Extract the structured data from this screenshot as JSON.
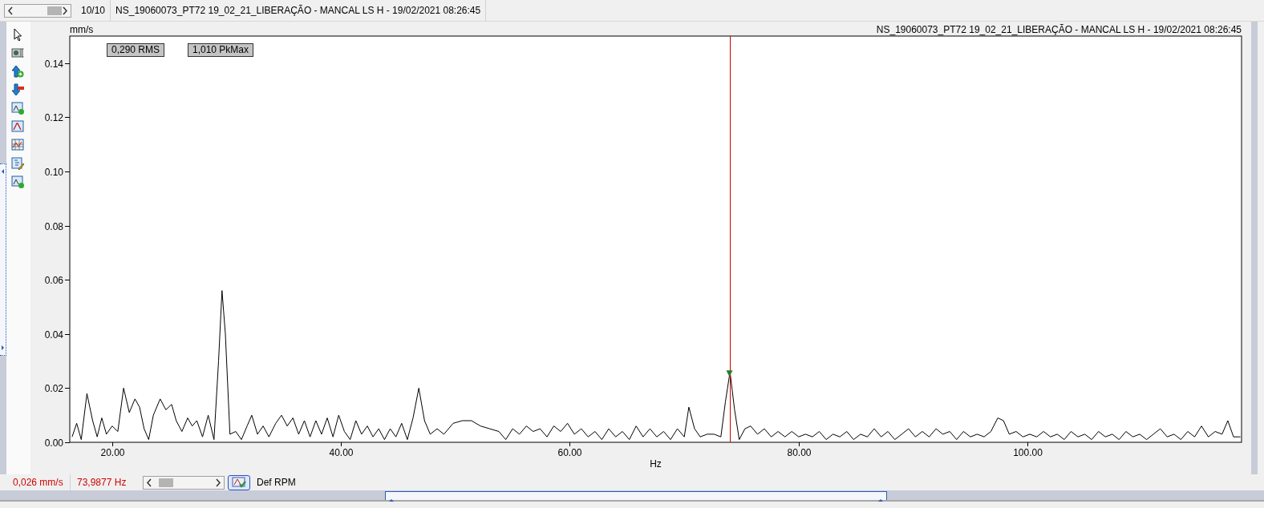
{
  "header": {
    "counter": "10/10",
    "title": "NS_19060073_PT72 19_02_21_LIBERAÇÃO - MANCAL LS H - 19/02/2021 08:26:45"
  },
  "chart": {
    "readouts": [
      "0,290 RMS",
      "1,010 PkMax"
    ],
    "chart_data": {
      "type": "line",
      "title": "NS_19060073_PT72 19_02_21_LIBERAÇÃO - MANCAL LS H - 19/02/2021 08:26:45",
      "xlabel": "Hz",
      "ylabel": "mm/s",
      "x": [
        16.5,
        16.9,
        17.3,
        17.8,
        18.3,
        18.7,
        19.1,
        19.5,
        20.0,
        20.5,
        21.0,
        21.5,
        22.0,
        22.4,
        22.8,
        23.2,
        23.6,
        24.2,
        24.7,
        25.2,
        25.6,
        26.1,
        26.6,
        27.0,
        27.4,
        27.9,
        28.4,
        28.9,
        29.3,
        29.6,
        29.9,
        30.3,
        30.8,
        31.3,
        31.8,
        32.2,
        32.7,
        33.2,
        33.7,
        34.3,
        34.8,
        35.3,
        35.8,
        36.3,
        36.8,
        37.3,
        37.8,
        38.3,
        38.8,
        39.3,
        39.8,
        40.3,
        40.8,
        41.3,
        41.8,
        42.3,
        42.8,
        43.3,
        43.8,
        44.3,
        44.8,
        45.3,
        45.8,
        46.3,
        46.8,
        47.3,
        47.8,
        48.4,
        49.0,
        49.8,
        50.6,
        51.4,
        52.2,
        53.0,
        53.8,
        54.4,
        55.0,
        55.6,
        56.2,
        56.8,
        57.4,
        58.0,
        58.6,
        59.2,
        59.8,
        60.4,
        61.0,
        61.6,
        62.2,
        62.8,
        63.4,
        64.0,
        64.6,
        65.2,
        65.8,
        66.4,
        67.0,
        67.6,
        68.2,
        68.8,
        69.4,
        70.0,
        70.4,
        70.9,
        71.4,
        72.0,
        72.6,
        73.2,
        73.6,
        74.0,
        74.4,
        74.8,
        75.3,
        75.8,
        76.4,
        77.0,
        77.6,
        78.2,
        78.8,
        79.4,
        80.0,
        80.6,
        81.2,
        81.8,
        82.4,
        83.0,
        83.6,
        84.2,
        84.8,
        85.4,
        86.0,
        86.6,
        87.2,
        87.8,
        88.4,
        89.0,
        89.6,
        90.2,
        90.8,
        91.4,
        92.0,
        92.6,
        93.2,
        93.8,
        94.4,
        95.0,
        95.6,
        96.2,
        96.8,
        97.4,
        97.9,
        98.4,
        99.0,
        99.6,
        100.2,
        100.8,
        101.4,
        102.0,
        102.6,
        103.2,
        103.8,
        104.4,
        105.0,
        105.6,
        106.2,
        106.8,
        107.4,
        108.0,
        108.6,
        109.2,
        109.8,
        110.4,
        111.0,
        111.6,
        112.2,
        112.8,
        113.4,
        114.0,
        114.6,
        115.2,
        115.8,
        116.4,
        117.0,
        117.5,
        118.0,
        118.6
      ],
      "series": [
        {
          "color": "#000000",
          "values": [
            0.002,
            0.007,
            0.001,
            0.018,
            0.008,
            0.002,
            0.009,
            0.003,
            0.006,
            0.004,
            0.02,
            0.011,
            0.016,
            0.013,
            0.005,
            0.001,
            0.01,
            0.016,
            0.012,
            0.014,
            0.008,
            0.004,
            0.009,
            0.006,
            0.008,
            0.002,
            0.01,
            0.001,
            0.03,
            0.056,
            0.04,
            0.003,
            0.004,
            0.001,
            0.006,
            0.01,
            0.003,
            0.006,
            0.002,
            0.007,
            0.01,
            0.006,
            0.009,
            0.003,
            0.008,
            0.002,
            0.008,
            0.003,
            0.009,
            0.002,
            0.01,
            0.004,
            0.001,
            0.008,
            0.003,
            0.006,
            0.002,
            0.005,
            0.001,
            0.005,
            0.002,
            0.007,
            0.001,
            0.009,
            0.02,
            0.008,
            0.003,
            0.005,
            0.003,
            0.007,
            0.008,
            0.008,
            0.006,
            0.005,
            0.004,
            0.001,
            0.005,
            0.003,
            0.006,
            0.004,
            0.005,
            0.002,
            0.006,
            0.004,
            0.007,
            0.003,
            0.005,
            0.002,
            0.004,
            0.001,
            0.005,
            0.002,
            0.004,
            0.001,
            0.006,
            0.002,
            0.005,
            0.002,
            0.004,
            0.001,
            0.005,
            0.002,
            0.013,
            0.005,
            0.002,
            0.003,
            0.003,
            0.002,
            0.015,
            0.026,
            0.012,
            0.001,
            0.005,
            0.006,
            0.003,
            0.005,
            0.002,
            0.004,
            0.002,
            0.004,
            0.002,
            0.003,
            0.002,
            0.004,
            0.001,
            0.003,
            0.002,
            0.004,
            0.001,
            0.003,
            0.002,
            0.005,
            0.002,
            0.004,
            0.001,
            0.003,
            0.005,
            0.002,
            0.004,
            0.002,
            0.005,
            0.003,
            0.004,
            0.001,
            0.004,
            0.002,
            0.003,
            0.002,
            0.004,
            0.009,
            0.008,
            0.003,
            0.004,
            0.002,
            0.003,
            0.002,
            0.004,
            0.002,
            0.003,
            0.001,
            0.004,
            0.002,
            0.003,
            0.001,
            0.004,
            0.002,
            0.003,
            0.001,
            0.004,
            0.002,
            0.003,
            0.001,
            0.003,
            0.005,
            0.002,
            0.003,
            0.001,
            0.004,
            0.002,
            0.006,
            0.002,
            0.004,
            0.003,
            0.008,
            0.002,
            0.002
          ]
        }
      ],
      "xlim": [
        16.3,
        118.7
      ],
      "ylim": [
        0,
        0.15
      ],
      "xticks": [
        {
          "value": 20,
          "label": "20.00"
        },
        {
          "value": 40,
          "label": "40.00"
        },
        {
          "value": 60,
          "label": "60.00"
        },
        {
          "value": 80,
          "label": "80.00"
        },
        {
          "value": 100,
          "label": "100.00"
        }
      ],
      "yticks": [
        {
          "value": 0,
          "label": "0.00"
        },
        {
          "value": 0.02,
          "label": "0.02"
        },
        {
          "value": 0.04,
          "label": "0.04"
        },
        {
          "value": 0.06,
          "label": "0.06"
        },
        {
          "value": 0.08,
          "label": "0.08"
        },
        {
          "value": 0.1,
          "label": "0.10"
        },
        {
          "value": 0.12,
          "label": "0.12"
        },
        {
          "value": 0.14,
          "label": "0.14"
        }
      ],
      "ref_lines": [
        {
          "axis": "x",
          "value": 73.9877,
          "color": "#cc0000"
        }
      ]
    }
  },
  "status": {
    "amplitude": "0,026 mm/s",
    "frequency": "73,9877 Hz",
    "rpm_label": "Def RPM"
  }
}
